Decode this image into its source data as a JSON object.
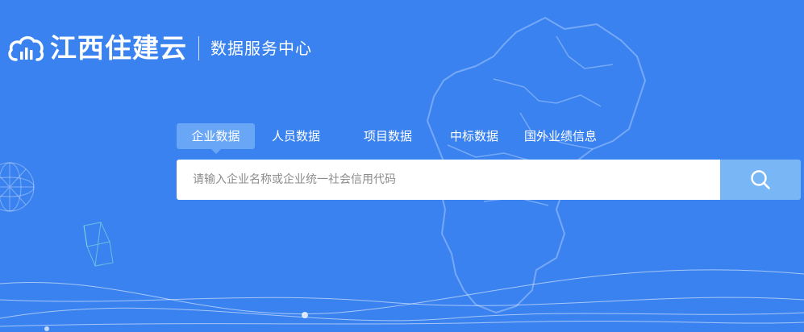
{
  "header": {
    "brand": "江西住建云",
    "subtitle": "数据服务中心",
    "logo_icon": "cloud-chart-icon"
  },
  "tabs": [
    {
      "label": "企业数据",
      "active": true
    },
    {
      "label": "人员数据",
      "active": false
    },
    {
      "label": "项目数据",
      "active": false
    },
    {
      "label": "中标数据",
      "active": false
    },
    {
      "label": "国外业绩信息",
      "active": false
    }
  ],
  "search": {
    "placeholder": "请输入企业名称或企业统一社会信用代码",
    "value": "",
    "icon": "search-icon"
  },
  "colors": {
    "background": "#3a82f0",
    "active_tab": "#6aa6f6",
    "search_button": "#79b6f5",
    "text": "#ffffff"
  }
}
